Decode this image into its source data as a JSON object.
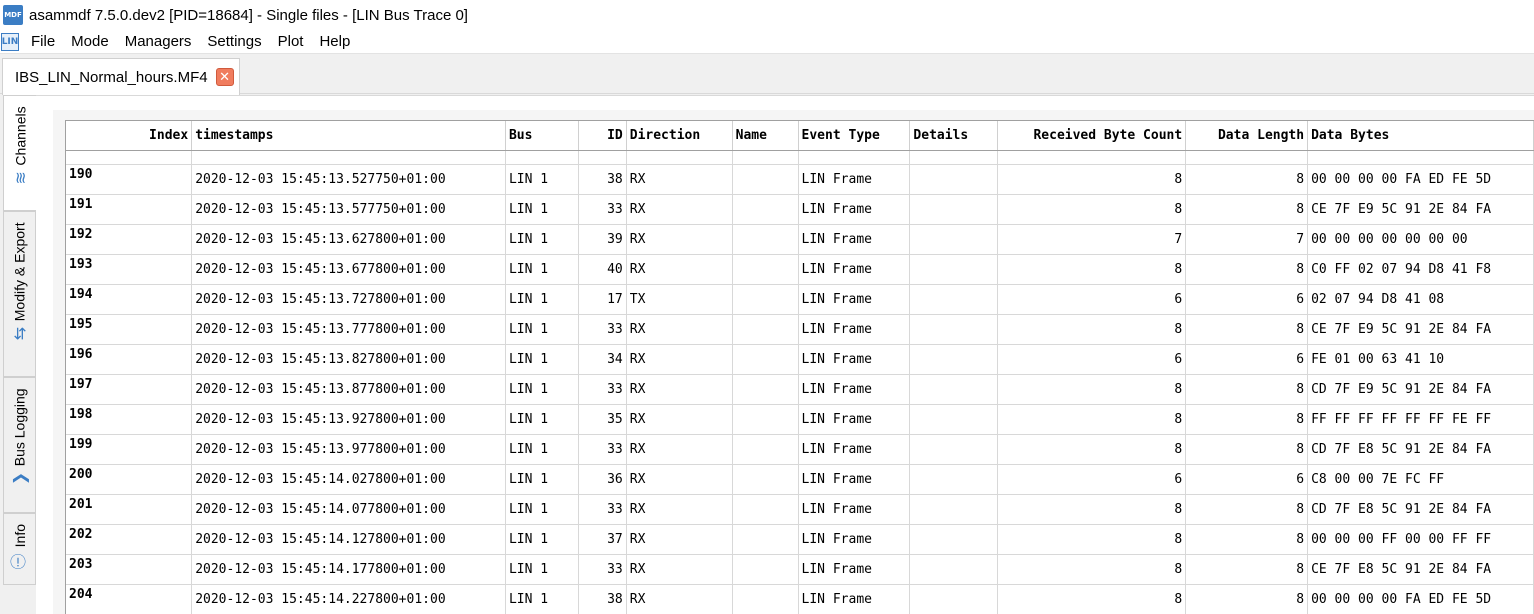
{
  "window": {
    "title": "asammdf 7.5.0.dev2 [PID=18684] - Single files - [LIN Bus Trace 0]",
    "logo_text": "MDF"
  },
  "menu": {
    "logo_text": "LIN",
    "items": [
      "File",
      "Mode",
      "Managers",
      "Settings",
      "Plot",
      "Help"
    ]
  },
  "file_tab": {
    "label": "IBS_LIN_Normal_hours.MF4",
    "close_glyph": "✕"
  },
  "side_tabs": [
    {
      "label": "Channels",
      "icon": "signal-wave-icon",
      "glyph": "≋"
    },
    {
      "label": "Modify & Export",
      "icon": "sync-arrows-icon",
      "glyph": "⇆"
    },
    {
      "label": "Bus Logging",
      "icon": "chevron-right-icon",
      "glyph": "❯"
    },
    {
      "label": "Info",
      "icon": "info-icon",
      "glyph": "ⓘ"
    }
  ],
  "table": {
    "columns": [
      "Index",
      "timestamps",
      "Bus",
      "ID",
      "Direction",
      "Name",
      "Event Type",
      "Details",
      "Received Byte Count",
      "Data Length",
      "Data Bytes"
    ],
    "rows": [
      [
        "190",
        "2020-12-03 15:45:13.527750+01:00",
        "LIN 1",
        "38",
        "RX",
        "",
        "LIN Frame",
        "",
        "8",
        "8",
        "00 00 00 00 FA ED FE 5D"
      ],
      [
        "191",
        "2020-12-03 15:45:13.577750+01:00",
        "LIN 1",
        "33",
        "RX",
        "",
        "LIN Frame",
        "",
        "8",
        "8",
        "CE 7F E9 5C 91 2E 84 FA"
      ],
      [
        "192",
        "2020-12-03 15:45:13.627800+01:00",
        "LIN 1",
        "39",
        "RX",
        "",
        "LIN Frame",
        "",
        "7",
        "7",
        "00 00 00 00 00 00 00"
      ],
      [
        "193",
        "2020-12-03 15:45:13.677800+01:00",
        "LIN 1",
        "40",
        "RX",
        "",
        "LIN Frame",
        "",
        "8",
        "8",
        "C0 FF 02 07 94 D8 41 F8"
      ],
      [
        "194",
        "2020-12-03 15:45:13.727800+01:00",
        "LIN 1",
        "17",
        "TX",
        "",
        "LIN Frame",
        "",
        "6",
        "6",
        "02 07 94 D8 41 08"
      ],
      [
        "195",
        "2020-12-03 15:45:13.777800+01:00",
        "LIN 1",
        "33",
        "RX",
        "",
        "LIN Frame",
        "",
        "8",
        "8",
        "CE 7F E9 5C 91 2E 84 FA"
      ],
      [
        "196",
        "2020-12-03 15:45:13.827800+01:00",
        "LIN 1",
        "34",
        "RX",
        "",
        "LIN Frame",
        "",
        "6",
        "6",
        "FE 01 00 63 41 10"
      ],
      [
        "197",
        "2020-12-03 15:45:13.877800+01:00",
        "LIN 1",
        "33",
        "RX",
        "",
        "LIN Frame",
        "",
        "8",
        "8",
        "CD 7F E9 5C 91 2E 84 FA"
      ],
      [
        "198",
        "2020-12-03 15:45:13.927800+01:00",
        "LIN 1",
        "35",
        "RX",
        "",
        "LIN Frame",
        "",
        "8",
        "8",
        "FF FF FF FF FF FF FE FF"
      ],
      [
        "199",
        "2020-12-03 15:45:13.977800+01:00",
        "LIN 1",
        "33",
        "RX",
        "",
        "LIN Frame",
        "",
        "8",
        "8",
        "CD 7F E8 5C 91 2E 84 FA"
      ],
      [
        "200",
        "2020-12-03 15:45:14.027800+01:00",
        "LIN 1",
        "36",
        "RX",
        "",
        "LIN Frame",
        "",
        "6",
        "6",
        "C8 00 00 7E FC FF"
      ],
      [
        "201",
        "2020-12-03 15:45:14.077800+01:00",
        "LIN 1",
        "33",
        "RX",
        "",
        "LIN Frame",
        "",
        "8",
        "8",
        "CD 7F E8 5C 91 2E 84 FA"
      ],
      [
        "202",
        "2020-12-03 15:45:14.127800+01:00",
        "LIN 1",
        "37",
        "RX",
        "",
        "LIN Frame",
        "",
        "8",
        "8",
        "00 00 00 FF 00 00 FF FF"
      ],
      [
        "203",
        "2020-12-03 15:45:14.177800+01:00",
        "LIN 1",
        "33",
        "RX",
        "",
        "LIN Frame",
        "",
        "8",
        "8",
        "CE 7F E8 5C 91 2E 84 FA"
      ],
      [
        "204",
        "2020-12-03 15:45:14.227800+01:00",
        "LIN 1",
        "38",
        "RX",
        "",
        "LIN Frame",
        "",
        "8",
        "8",
        "00 00 00 00 FA ED FE 5D"
      ]
    ]
  },
  "colors": {
    "accent": "#3b7dc4",
    "close": "#f07c5e"
  }
}
